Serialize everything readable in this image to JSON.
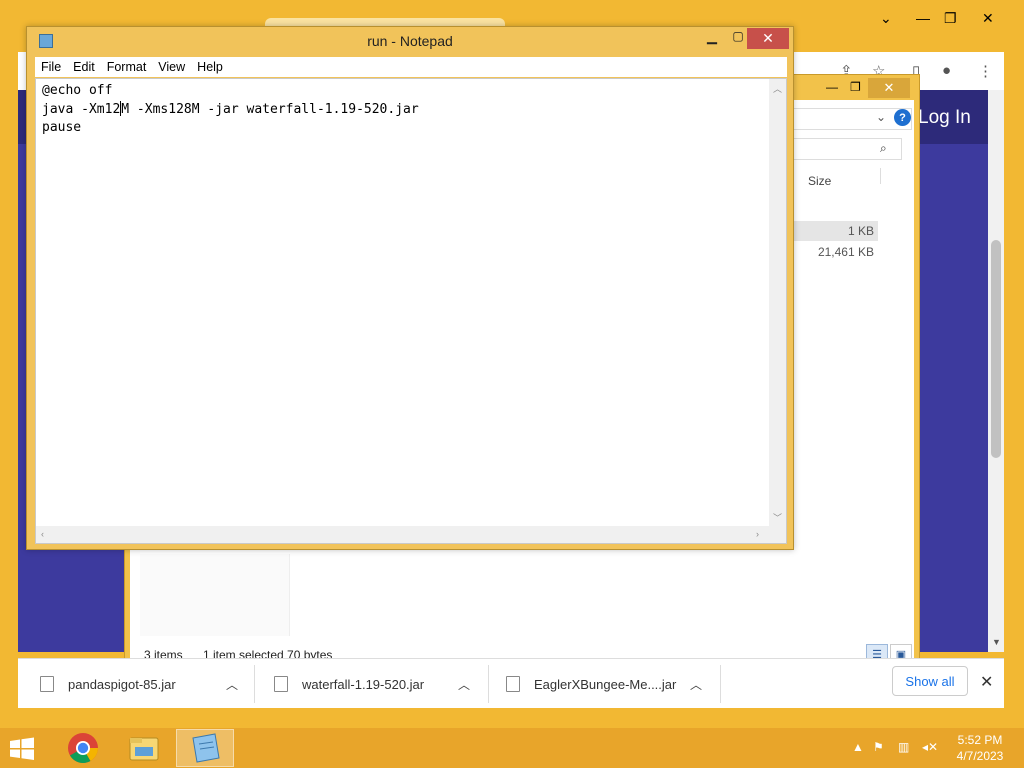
{
  "chrome": {
    "page_button": "Log In",
    "controls": {
      "minimize": "—",
      "maximize": "❐",
      "close": "✕",
      "dropdown": "⌄"
    },
    "toolbar_icons": [
      "share-icon",
      "star-icon",
      "sidebar-icon",
      "profile-icon",
      "menu-icon"
    ]
  },
  "explorer": {
    "column_size": "Size",
    "rows": [
      {
        "size": "1 KB",
        "selected": true
      },
      {
        "size": "21,461 KB",
        "selected": false
      }
    ],
    "status_items": "3 items",
    "status_selected": "1 item selected  70 bytes"
  },
  "downloads": {
    "items": [
      {
        "name": "pandaspigot-85.jar"
      },
      {
        "name": "waterfall-1.19-520.jar"
      },
      {
        "name": "EaglerXBungee-Me....jar"
      }
    ],
    "show_all": "Show all",
    "close": "✕"
  },
  "notepad": {
    "title": "run - Notepad",
    "menu": [
      "File",
      "Edit",
      "Format",
      "View",
      "Help"
    ],
    "line1": "@echo off",
    "line2_before_caret": "java -Xm12",
    "line2_after_caret": "M -Xms128M -jar waterfall-1.19-520.jar",
    "line3": "pause",
    "close": "✕"
  },
  "taskbar": {
    "apps": [
      "chrome-icon",
      "file-explorer-icon",
      "notepad-icon"
    ],
    "time": "5:52 PM",
    "date": "4/7/2023"
  },
  "colors": {
    "accent": "#f2b833",
    "page": "#3d3a9e",
    "close_red": "#c7504a",
    "link_blue": "#1a73e8"
  }
}
